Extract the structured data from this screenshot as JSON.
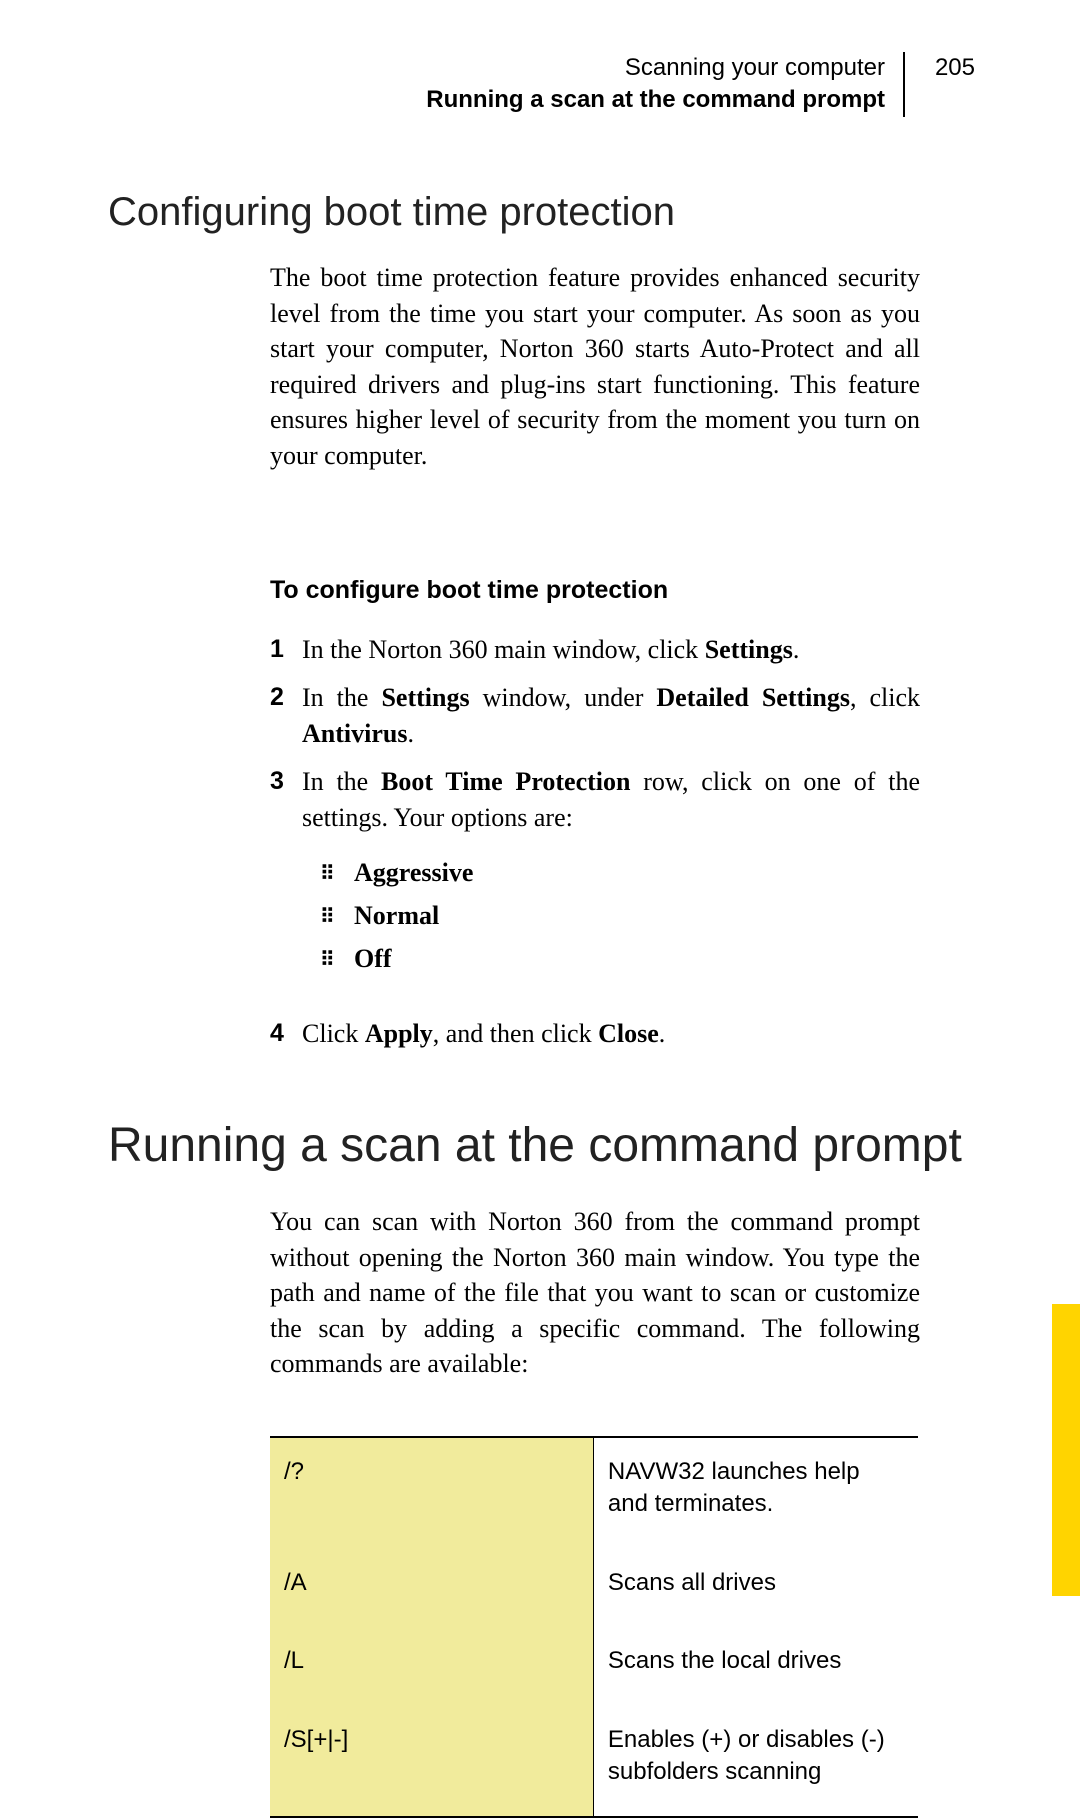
{
  "header": {
    "chapter": "Scanning your computer",
    "section": "Running a scan at the command prompt",
    "page_number": "205"
  },
  "section1": {
    "heading": "Configuring boot time protection",
    "intro": "The boot time protection feature provides enhanced security level from the time you start your computer. As soon as you start your computer, Norton 360 starts Auto-Protect and all required drivers and plug-ins start functioning. This feature ensures higher level of security from the moment you turn on your computer.",
    "procedure_title": "To configure boot time protection",
    "steps": {
      "n1": "1",
      "t1a": "In the Norton 360 main window, click ",
      "t1b": "Settings",
      "t1c": ".",
      "n2": "2",
      "t2a": "In the ",
      "t2b": "Settings",
      "t2c": " window, under ",
      "t2d": "Detailed Settings",
      "t2e": ", click ",
      "t2f": "Antivirus",
      "t2g": ".",
      "n3": "3",
      "t3a": "In the ",
      "t3b": "Boot Time Protection",
      "t3c": " row, click on one of the settings. Your options are:",
      "opt1": "Aggressive",
      "opt2": "Normal",
      "opt3": "Off",
      "n4": "4",
      "t4a": "Click ",
      "t4b": "Apply",
      "t4c": ", and then click ",
      "t4d": "Close",
      "t4e": "."
    }
  },
  "section2": {
    "heading": "Running a scan at the command prompt",
    "intro": "You can scan with Norton 360 from the command prompt without opening the Norton 360 main window. You type the path and name of the file that you want to scan or customize the scan by adding a specific command. The following commands are available:",
    "table": [
      {
        "cmd": "/?",
        "desc": "NAVW32 launches help and terminates."
      },
      {
        "cmd": "/A",
        "desc": "Scans all drives"
      },
      {
        "cmd": "/L",
        "desc": "Scans the local drives"
      },
      {
        "cmd": "/S[+|-]",
        "desc": "Enables (+) or disables (-) subfolders scanning"
      }
    ]
  },
  "colors": {
    "table_highlight": "#f1eb9c",
    "thumb_tab": "#ffd400"
  }
}
